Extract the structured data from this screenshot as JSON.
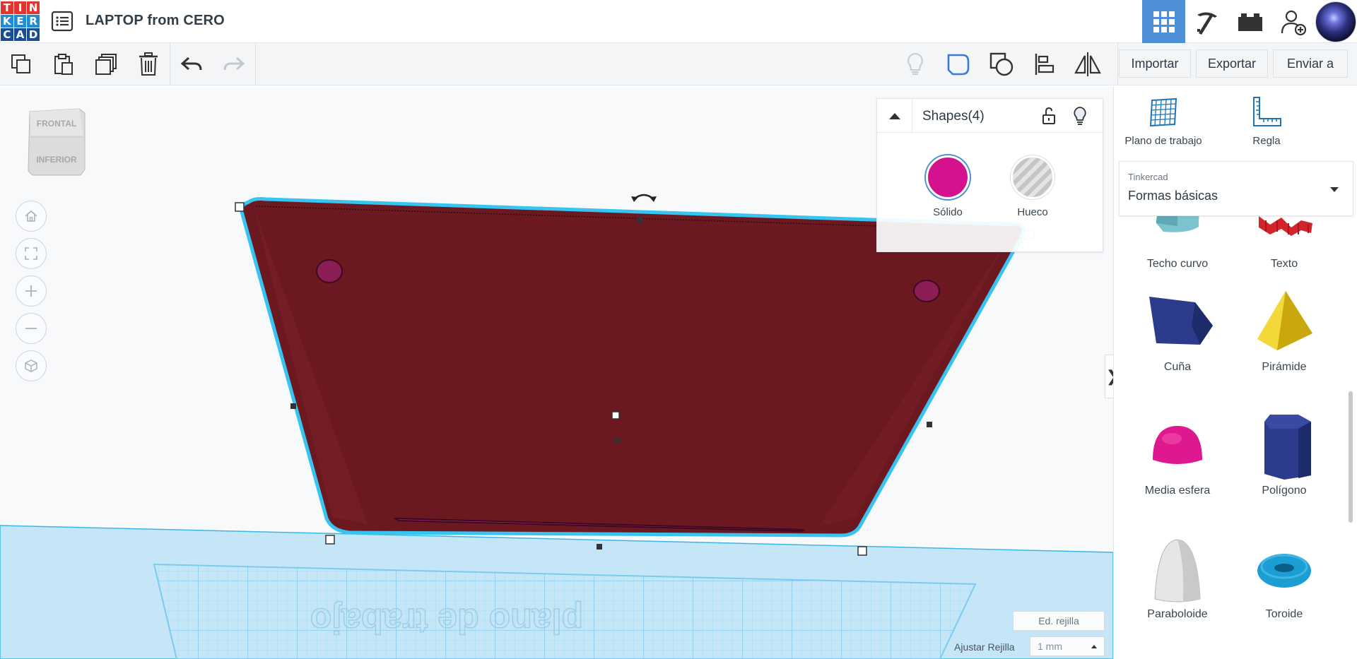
{
  "app": {
    "title": "LAPTOP from CERO",
    "logo_letters": [
      "T",
      "I",
      "N",
      "K",
      "E",
      "R",
      "C",
      "A",
      "D"
    ],
    "logo_colors": [
      "#e2352f",
      "#e2352f",
      "#e2352f",
      "#1f8dd6",
      "#1f8dd6",
      "#1f8dd6",
      "#1a4c91",
      "#1a4c91",
      "#1a4c91"
    ]
  },
  "topbar": {
    "buttons": [
      {
        "name": "grid-view-icon",
        "active": true
      },
      {
        "name": "pickaxe-icon",
        "active": false
      },
      {
        "name": "bricks-icon",
        "active": false
      },
      {
        "name": "add-user-icon",
        "active": false
      },
      {
        "name": "avatar",
        "active": false
      }
    ]
  },
  "toolbar": {
    "import_label": "Importar",
    "export_label": "Exportar",
    "send_label": "Enviar a"
  },
  "viewcube": {
    "front_label": "FRONTAL",
    "bottom_label": "INFERIOR"
  },
  "shapes_panel": {
    "title": "Shapes(4)",
    "solid_label": "Sólido",
    "hole_label": "Hueco",
    "solid_color": "#d6118e"
  },
  "workplane": {
    "mirrored_text": "plano de trabajo",
    "edit_grid_label": "Ed. rejilla",
    "snap_label": "Ajustar Rejilla",
    "snap_value": "1 mm"
  },
  "sidebar": {
    "workplane_label": "Plano de trabajo",
    "ruler_label": "Regla",
    "library_small": "Tinkercad",
    "library_value": "Formas básicas",
    "shapes": [
      {
        "label": "Techo curvo",
        "icon": "curved-roof-icon"
      },
      {
        "label": "Texto",
        "icon": "text-shape-icon"
      },
      {
        "label": "Cuña",
        "icon": "wedge-icon"
      },
      {
        "label": "Pirámide",
        "icon": "pyramid-icon"
      },
      {
        "label": "Media esfera",
        "icon": "half-sphere-icon"
      },
      {
        "label": "Polígono",
        "icon": "polygon-icon"
      },
      {
        "label": "Paraboloide",
        "icon": "paraboloid-icon"
      },
      {
        "label": "Toroide",
        "icon": "torus-icon"
      }
    ]
  },
  "colors": {
    "accent": "#4f8fd8",
    "object": "#6b1820",
    "selection_outline": "#33c2ee",
    "workplane": "#bfe3f5"
  }
}
